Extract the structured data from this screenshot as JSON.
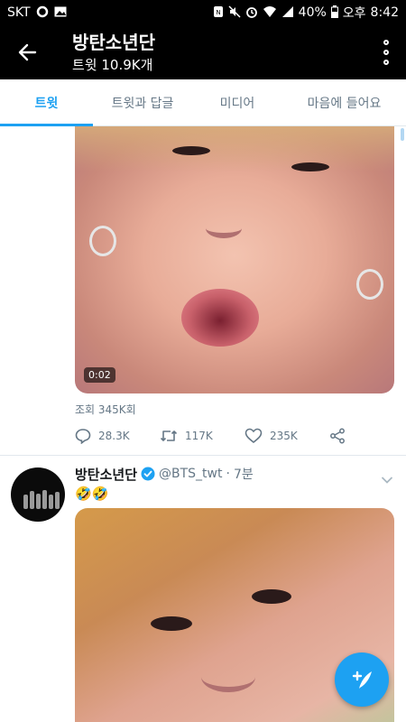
{
  "status_bar": {
    "carrier": "SKT",
    "battery_percent": "40%",
    "ampm": "오후",
    "time": "8:42",
    "icons": [
      "notification-icon",
      "image-icon",
      "nfc-icon",
      "mute-icon",
      "alarm-icon",
      "wifi-icon",
      "signal-icon",
      "battery-icon"
    ]
  },
  "app_bar": {
    "title": "방탄소년단",
    "subtitle": "트윗 10.9K개",
    "back_icon": "back-arrow-icon",
    "more_icon": "more-vertical-icon"
  },
  "tabs": [
    {
      "label": "트윗",
      "active": true
    },
    {
      "label": "트윗과 답글",
      "active": false
    },
    {
      "label": "미디어",
      "active": false
    },
    {
      "label": "마음에 들어요",
      "active": false
    }
  ],
  "tweet1": {
    "duration": "0:02",
    "views": "조회 345K회",
    "replies": "28.3K",
    "retweets": "117K",
    "likes": "235K"
  },
  "tweet2": {
    "name": "방탄소년단",
    "handle": "@BTS_twt",
    "separator": "·",
    "time": "7분",
    "text": "🤣🤣"
  },
  "colors": {
    "accent": "#1da1f2",
    "secondary_text": "#657786",
    "app_bar_bg": "#000000"
  },
  "fab": {
    "icon": "compose-tweet-icon"
  }
}
